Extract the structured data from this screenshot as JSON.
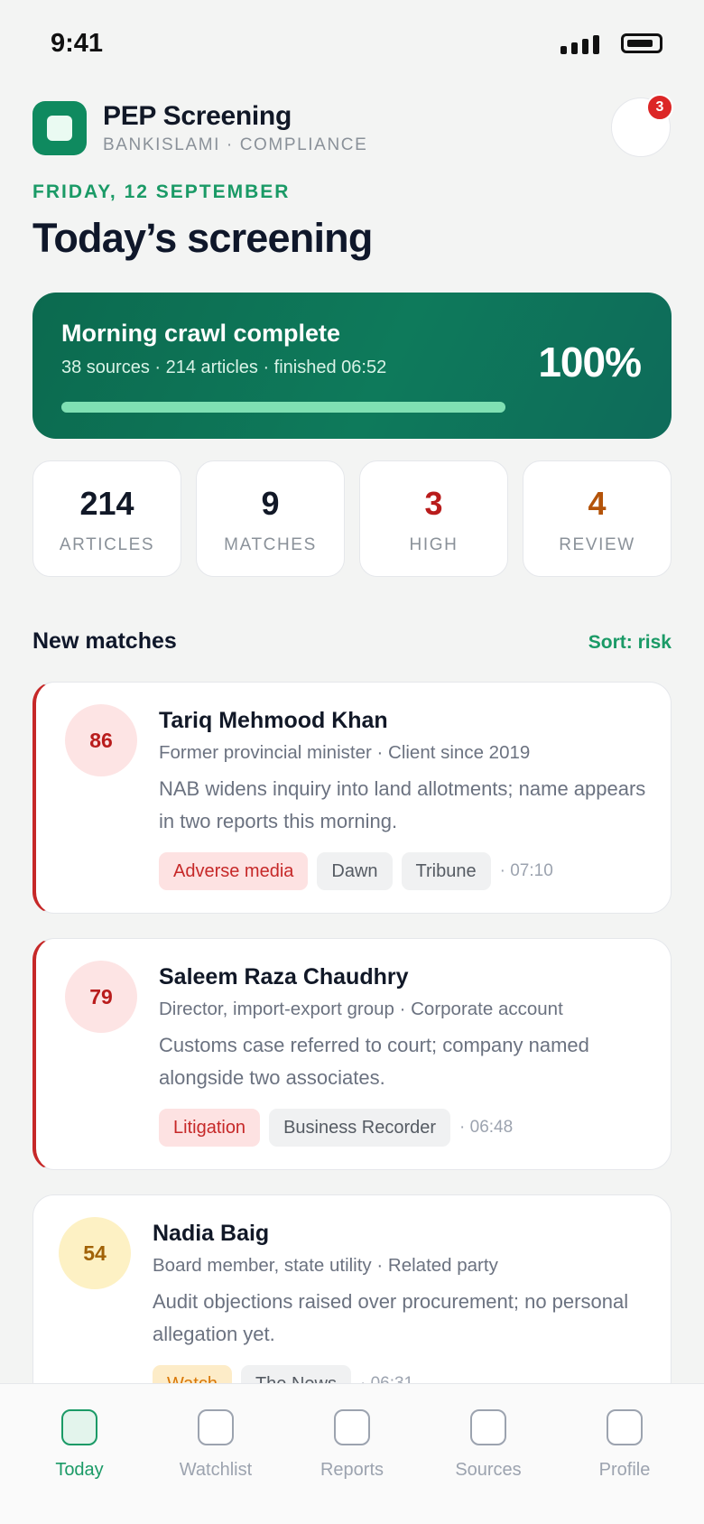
{
  "status_bar": {
    "time": "9:41"
  },
  "header": {
    "title": "PEP Screening",
    "subtitle": "BANKISLAMI · COMPLIANCE",
    "notification_count": "3"
  },
  "date_label": "FRIDAY, 12 SEPTEMBER",
  "page_title": "Today’s screening",
  "crawl": {
    "title": "Morning crawl complete",
    "meta": "38 sources · 214 articles · finished 06:52",
    "percent_label": "100%",
    "progress": 1.0
  },
  "stats": [
    {
      "value": "214",
      "label": "ARTICLES",
      "color": "#111827"
    },
    {
      "value": "9",
      "label": "MATCHES",
      "color": "#111827"
    },
    {
      "value": "3",
      "label": "HIGH",
      "color": "#b91c1c"
    },
    {
      "value": "4",
      "label": "REVIEW",
      "color": "#b45309"
    }
  ],
  "matches_section": {
    "title": "New matches",
    "sort_label": "Sort: risk"
  },
  "matches": [
    {
      "score": "86",
      "name": "Tariq Mehmood Khan",
      "role": "Former provincial minister · Client since 2019",
      "summary": "NAB widens inquiry into land allotments; name appears in two reports this morning.",
      "tags": [
        "Adverse media",
        "Dawn",
        "Tribune"
      ],
      "time": "· 07:10"
    },
    {
      "score": "79",
      "name": "Saleem Raza Chaudhry",
      "role": "Director, import-export group · Corporate account",
      "summary": "Customs case referred to court; company named alongside two associates.",
      "tags": [
        "Litigation",
        "Business Recorder"
      ],
      "time": "· 06:48"
    },
    {
      "score": "54",
      "name": "Nadia Baig",
      "role": "Board member, state utility · Related party",
      "summary": "Audit objections raised over procurement; no personal allegation yet.",
      "tags": [
        "Watch",
        "The News"
      ],
      "time": "· 06:31"
    }
  ],
  "bottom_nav": [
    {
      "label": "Today",
      "active": true
    },
    {
      "label": "Watchlist",
      "active": false
    },
    {
      "label": "Reports",
      "active": false
    },
    {
      "label": "Sources",
      "active": false
    },
    {
      "label": "Profile",
      "active": false
    }
  ]
}
